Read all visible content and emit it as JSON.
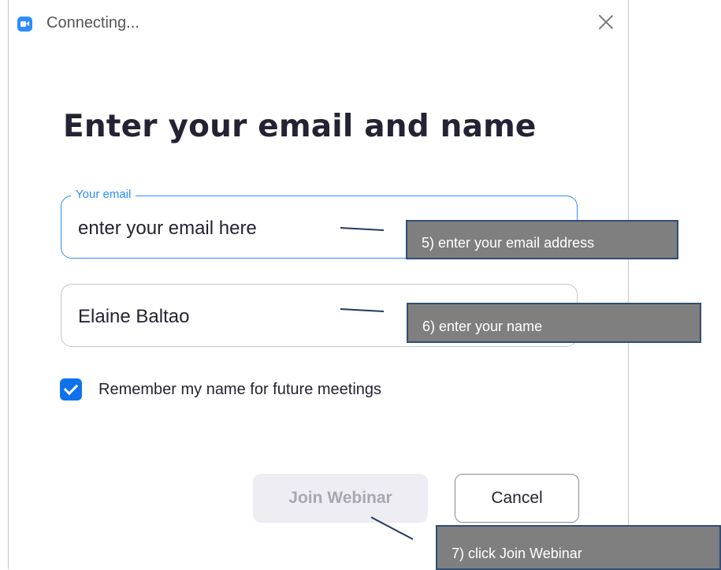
{
  "window": {
    "title": "Connecting...",
    "app_icon": "zoom-camera-icon",
    "close_icon": "close-icon"
  },
  "heading": "Enter your email and name",
  "email_field": {
    "legend": "Your email",
    "value": "enter your email here"
  },
  "name_field": {
    "value": "Elaine Baltao"
  },
  "remember": {
    "label": "Remember my name for future meetings",
    "checked": true
  },
  "buttons": {
    "join": "Join Webinar",
    "cancel": "Cancel"
  },
  "annotations": {
    "step5": "5) enter your email address",
    "step6": "6) enter your name",
    "step7": "7) click Join Webinar"
  },
  "colors": {
    "accent": "#2d8cff",
    "checkbox": "#0e72ed",
    "callout_bg": "#7f7f7f",
    "callout_border": "#2f4f75"
  }
}
